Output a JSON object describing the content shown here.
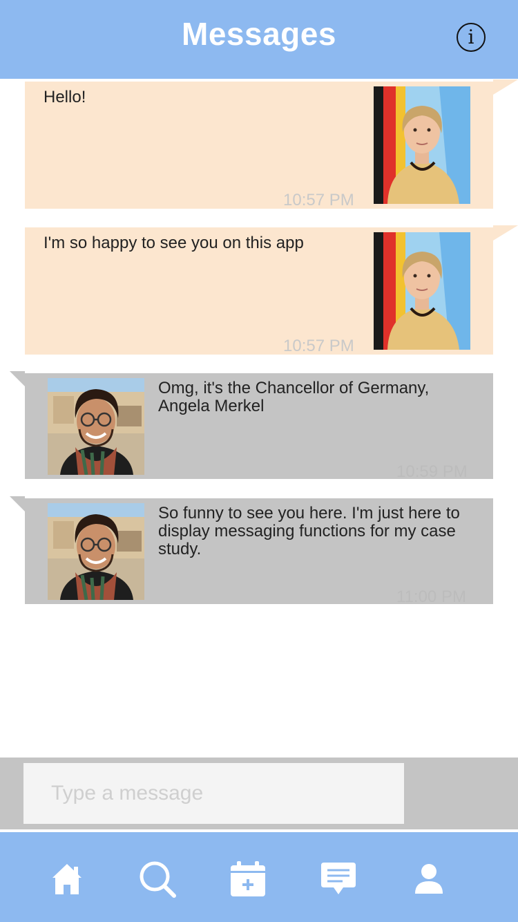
{
  "header": {
    "title": "Messages",
    "info_icon": "info-icon"
  },
  "messages": [
    {
      "direction": "outgoing",
      "text": "Hello!",
      "time": "10:57 PM",
      "avatar": "angela-merkel-photo"
    },
    {
      "direction": "outgoing",
      "text": "I'm so happy to see you on this app",
      "time": "10:57 PM",
      "avatar": "angela-merkel-photo"
    },
    {
      "direction": "incoming",
      "text": "Omg, it's the Chancellor of Germany, Angela Merkel",
      "time": "10:59 PM",
      "avatar": "user-photo"
    },
    {
      "direction": "incoming",
      "text": "So funny to see you here. I'm just here to display messaging functions for my case study.",
      "time": "11:00 PM",
      "avatar": "user-photo"
    }
  ],
  "composer": {
    "placeholder": "Type a message"
  },
  "nav": {
    "items": [
      {
        "icon": "home-icon"
      },
      {
        "icon": "search-icon"
      },
      {
        "icon": "calendar-add-icon"
      },
      {
        "icon": "messages-icon"
      },
      {
        "icon": "profile-icon"
      }
    ]
  },
  "colors": {
    "header": "#8db9f0",
    "outgoing_bubble": "#fce6cf",
    "incoming_bubble": "#c4c4c4",
    "composer_bg": "#c4c4c4"
  }
}
